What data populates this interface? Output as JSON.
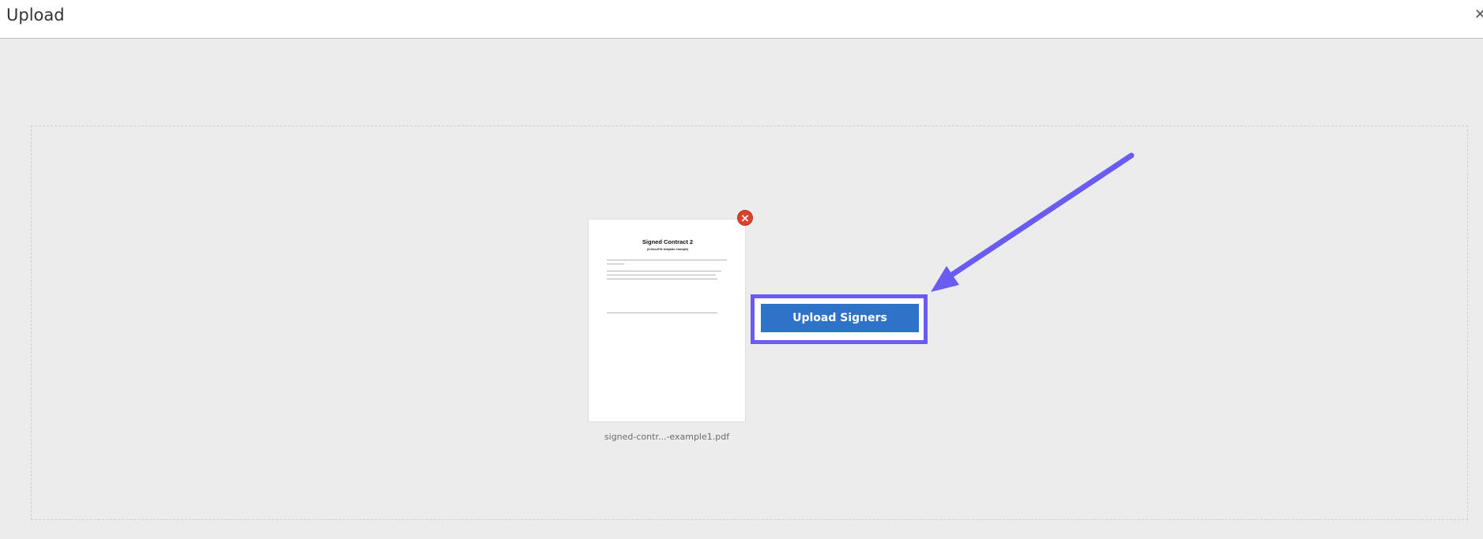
{
  "header": {
    "title": "Upload"
  },
  "file": {
    "name": "signed-contr...-example1.pdf",
    "preview": {
      "title": "Signed Contract 2",
      "subtitle": "(A DocuFile template example)"
    }
  },
  "actions": {
    "upload_signers_label": "Upload Signers"
  },
  "colors": {
    "annotation": "#6a5cf0",
    "button": "#2e73c7",
    "remove": "#d9422c"
  },
  "icons": {
    "close": "close-icon",
    "remove": "remove-file-icon",
    "arrow": "annotation-arrow"
  }
}
